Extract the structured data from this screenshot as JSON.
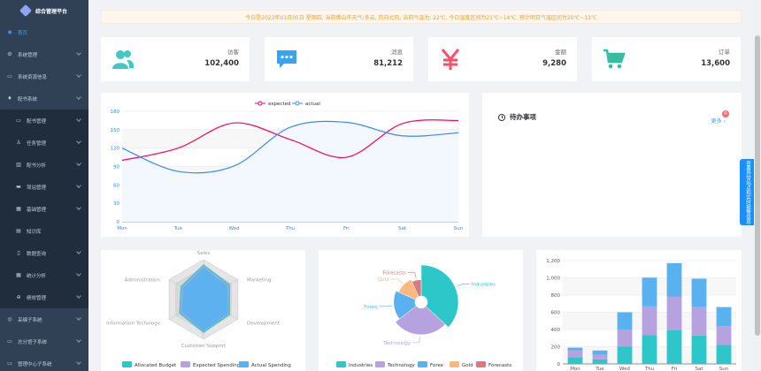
{
  "app": {
    "title": "综合管理平台"
  },
  "sidebar": {
    "items": [
      {
        "label": "首页",
        "icon": "dashboard-icon",
        "active": true,
        "sub": false,
        "chevron": false
      },
      {
        "label": "系统管理",
        "icon": "gear-icon",
        "active": false,
        "sub": false,
        "chevron": true
      },
      {
        "label": "系统资源信息",
        "icon": "monitor-icon",
        "active": false,
        "sub": false,
        "chevron": true
      },
      {
        "label": "配书系统",
        "icon": "bell-icon",
        "active": false,
        "sub": false,
        "chevron": true
      },
      {
        "label": "配书管理",
        "icon": "monitor-icon",
        "active": false,
        "sub": true,
        "chevron": true
      },
      {
        "label": "任务管理",
        "icon": "person-icon",
        "active": false,
        "sub": true,
        "chevron": true
      },
      {
        "label": "配书分析",
        "icon": "bar-chart-icon",
        "active": false,
        "sub": true,
        "chevron": true
      },
      {
        "label": "驾站管理",
        "icon": "folder-icon",
        "active": false,
        "sub": true,
        "chevron": true
      },
      {
        "label": "基础管理",
        "icon": "grid-icon",
        "active": false,
        "sub": true,
        "chevron": true
      },
      {
        "label": "知识库",
        "icon": "book-icon",
        "active": false,
        "sub": true,
        "chevron": false
      },
      {
        "label": "数据查询",
        "icon": "document-icon",
        "active": false,
        "sub": true,
        "chevron": true
      },
      {
        "label": "统计分析",
        "icon": "grid-icon",
        "active": false,
        "sub": true,
        "chevron": true
      },
      {
        "label": "绩效管理",
        "icon": "link-icon",
        "active": false,
        "sub": true,
        "chevron": true
      },
      {
        "label": "采编子系统",
        "icon": "target-icon",
        "active": false,
        "sub": false,
        "chevron": true
      },
      {
        "label": "总分馆子系统",
        "icon": "monitor-icon",
        "active": false,
        "sub": false,
        "chevron": true
      },
      {
        "label": "管理中心子系统",
        "icon": "monitor-icon",
        "active": false,
        "sub": false,
        "chevron": true
      }
    ]
  },
  "notice": {
    "text": "今日是2023年01月05日 星期四, 当前佛山市天气:多云, 风向北风, 当前气温为: 22℃, 今日温度区间为21℃~14℃, 预计明日气温区间为20℃~13℃"
  },
  "stats": [
    {
      "label": "访客",
      "value": "102,400",
      "icon": "people-icon",
      "color": "#40c9c6"
    },
    {
      "label": "消息",
      "value": "81,212",
      "icon": "message-icon",
      "color": "#36a3f7"
    },
    {
      "label": "金额",
      "value": "9,280",
      "icon": "yen-icon",
      "color": "#f4516c"
    },
    {
      "label": "订单",
      "value": "13,600",
      "icon": "shopping-cart-icon",
      "color": "#34bfa3"
    }
  ],
  "todo": {
    "title": "待办事项",
    "more": "更多",
    "badge": "0"
  },
  "side_tab": {
    "label": "查看异常站点和实时报警信息"
  },
  "chart_data": [
    {
      "type": "line",
      "categories": [
        "Mon",
        "Tue",
        "Wed",
        "Thu",
        "Fri",
        "Sat",
        "Sun"
      ],
      "ylim": [
        0,
        180
      ],
      "yticks": [
        0,
        30,
        60,
        90,
        120,
        150,
        180
      ],
      "legend": "top",
      "series": [
        {
          "name": "expected",
          "values": [
            100,
            120,
            161,
            134,
            105,
            160,
            165
          ],
          "color": "#ff005a"
        },
        {
          "name": "actual",
          "values": [
            120,
            82,
            91,
            154,
            162,
            140,
            145
          ],
          "color": "#3888fa"
        }
      ]
    },
    {
      "type": "radar",
      "indicators": [
        "Sales",
        "Marketing",
        "Development",
        "Customer Support",
        "Information Techology",
        "Administration"
      ],
      "legend": "bottom",
      "series": [
        {
          "name": "Allocated Budget",
          "color": "#2ec7c9"
        },
        {
          "name": "Expected Spending",
          "color": "#b6a2de"
        },
        {
          "name": "Actual Spending",
          "color": "#5ab1ef"
        }
      ]
    },
    {
      "type": "pie",
      "rose": true,
      "legend": "bottom",
      "slices": [
        {
          "name": "Industries",
          "value": 320,
          "color": "#2ec7c9"
        },
        {
          "name": "Technology",
          "value": 240,
          "color": "#b6a2de"
        },
        {
          "name": "Forex",
          "value": 149,
          "color": "#5ab1ef"
        },
        {
          "name": "Gold",
          "value": 100,
          "color": "#ffb980"
        },
        {
          "name": "Forecasts",
          "value": 59,
          "color": "#d87a80"
        }
      ]
    },
    {
      "type": "bar",
      "stacked": true,
      "categories": [
        "Mon",
        "Tue",
        "Wed",
        "Thu",
        "Fri",
        "Sat",
        "Sun"
      ],
      "ylim": [
        0,
        1200
      ],
      "yticks": [
        0,
        200,
        400,
        600,
        800,
        1000,
        1200
      ],
      "series": [
        {
          "values": [
            79,
            52,
            200,
            334,
            390,
            330,
            220
          ],
          "color": "#2ec7c9"
        },
        {
          "values": [
            80,
            52,
            200,
            334,
            390,
            330,
            220
          ],
          "color": "#b6a2de"
        },
        {
          "values": [
            30,
            52,
            200,
            334,
            390,
            330,
            220
          ],
          "color": "#5ab1ef"
        }
      ]
    }
  ]
}
